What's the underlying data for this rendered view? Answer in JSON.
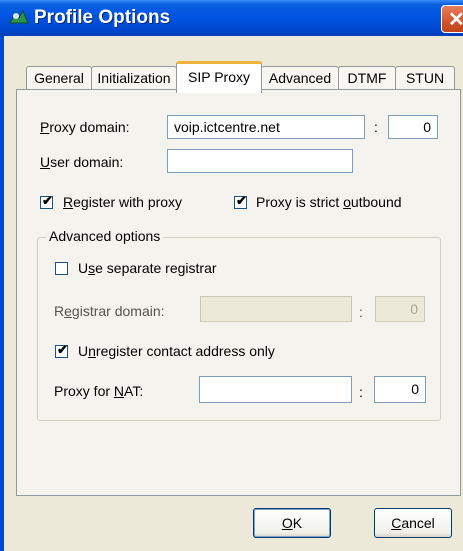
{
  "window": {
    "title": "Profile Options"
  },
  "tabs": [
    {
      "label": "General"
    },
    {
      "label": "Initialization"
    },
    {
      "label": "SIP Proxy",
      "active": true
    },
    {
      "label": "Advanced"
    },
    {
      "label": "DTMF"
    },
    {
      "label": "STUN"
    }
  ],
  "sip_proxy": {
    "proxy_domain": {
      "label_mnemonic": "P",
      "label_rest": "roxy domain:",
      "value": "voip.ictcentre.net",
      "port": "0"
    },
    "user_domain": {
      "label_mnemonic": "U",
      "label_rest": "ser domain:",
      "value": ""
    },
    "register_with_proxy": {
      "label_mnemonic": "R",
      "label_rest": "egister with proxy",
      "checked": true
    },
    "proxy_strict_outbound": {
      "label_before": "Proxy is strict ",
      "label_mnemonic": "o",
      "label_after": "utbound",
      "checked": true
    },
    "advanced_options": {
      "legend": "Advanced options",
      "use_separate_registrar": {
        "label_before": "U",
        "label_mnemonic": "s",
        "label_after": "e separate registrar",
        "checked": false
      },
      "registrar_domain": {
        "label_before": "R",
        "label_mnemonic": "e",
        "label_after": "gistrar domain:",
        "value": "",
        "port": "0",
        "disabled": true
      },
      "unregister_contact": {
        "label_before": "U",
        "label_mnemonic": "n",
        "label_after": "register contact address only",
        "checked": true
      },
      "proxy_for_nat": {
        "label_before": "Proxy for ",
        "label_mnemonic": "N",
        "label_after": "AT:",
        "value": "",
        "port": "0"
      }
    }
  },
  "buttons": {
    "ok": {
      "mnemonic": "O",
      "rest": "K"
    },
    "cancel": {
      "mnemonic": "C",
      "rest": "ancel"
    }
  },
  "colon": ":",
  "checkmark_glyph": "✔",
  "close_glyph": "✕"
}
